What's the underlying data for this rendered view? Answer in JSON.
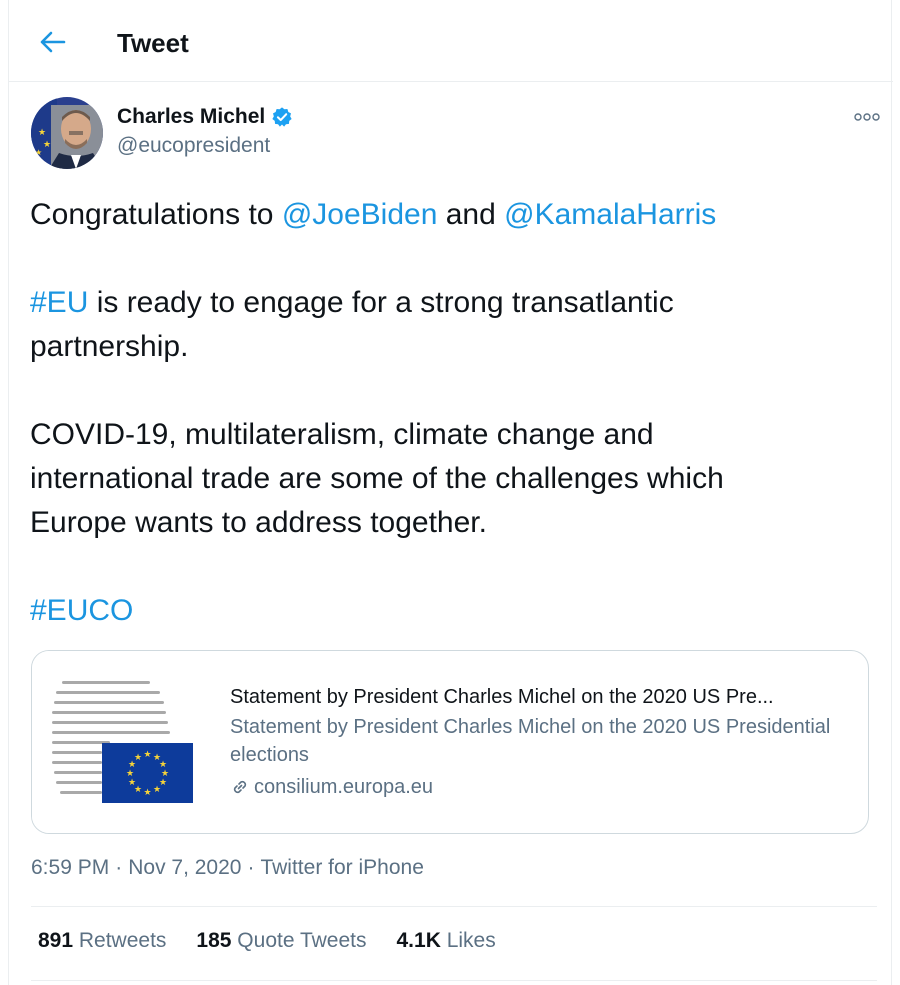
{
  "header": {
    "back_icon": "arrow-left-icon",
    "title": "Tweet"
  },
  "author": {
    "name": "Charles Michel",
    "handle": "@eucopresident",
    "verified_icon": "verified-badge-icon",
    "more_icon": "more-horizontal-icon"
  },
  "tweet": {
    "line1_prefix": "Congratulations to ",
    "mention1": "@JoeBiden",
    "line1_mid": " and ",
    "mention2": "@KamalaHarris",
    "hashtag_eu": "#EU",
    "para2_rest": " is ready to engage for a strong transatlantic partnership.",
    "para3": "COVID-19, multilateralism, climate change and international trade are some of the challenges which Europe wants to address together.",
    "hashtag_euco": "#EUCO"
  },
  "card": {
    "title": "Statement by President Charles Michel on the 2020 US Pre...",
    "description": "Statement by President Charles Michel on the 2020 US Presidential elections",
    "domain": "consilium.europa.eu",
    "link_icon": "link-icon"
  },
  "meta": {
    "time": "6:59 PM",
    "separator": "·",
    "date": "Nov 7, 2020",
    "source": "Twitter for iPhone"
  },
  "stats": {
    "retweets_count": "891",
    "retweets_label": " Retweets",
    "quote_count": "185",
    "quote_label": " Quote Tweets",
    "likes_count": "4.1K",
    "likes_label": " Likes"
  },
  "colors": {
    "accent": "#1b95e0",
    "secondary_text": "#5b7083",
    "primary_text": "#0f1419",
    "border": "#cfd9de"
  }
}
